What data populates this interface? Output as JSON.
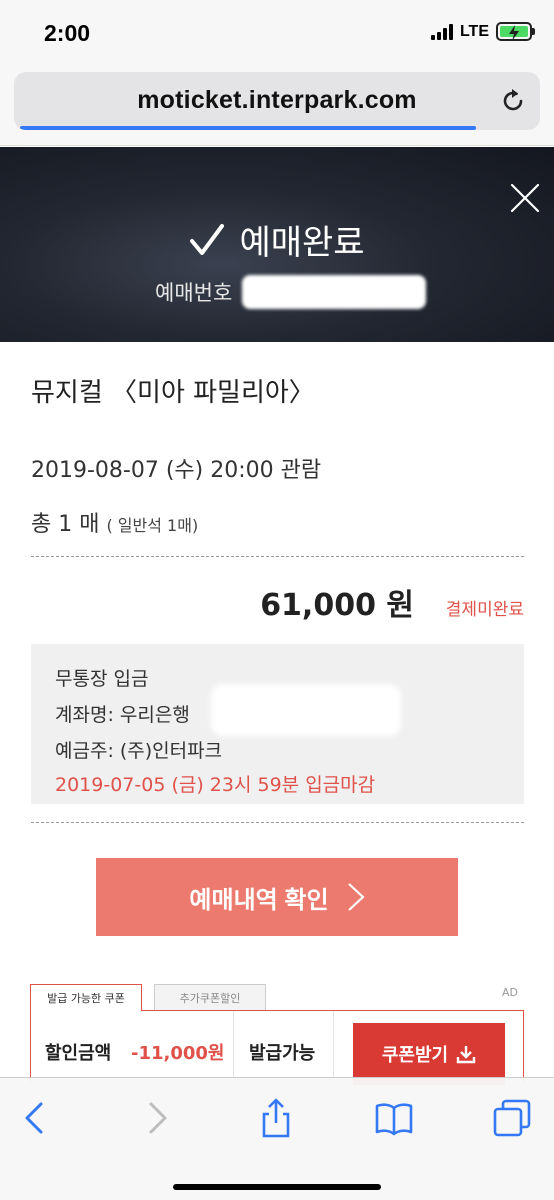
{
  "status": {
    "time": "2:00",
    "network": "LTE"
  },
  "browser": {
    "url": "moticket.interpark.com",
    "load_progress": 0.89
  },
  "banner": {
    "title": "예매완료",
    "booking_label": "예매번호"
  },
  "booking": {
    "show_title": "뮤지컬 〈미아 파밀리아〉",
    "datetime": "2019-08-07 (수) 20:00 관람",
    "qty_main": "총 1 매",
    "qty_detail": "( 일반석 1매)",
    "price": "61,000 원",
    "payment_status": "결제미완료"
  },
  "bank": {
    "method": "무통장 입금",
    "account": "계좌명: 우리은행",
    "holder": "예금주: (주)인터파크",
    "deadline": "2019-07-05 (금) 23시 59분 입금마감"
  },
  "confirm_button": {
    "label": "예매내역 확인"
  },
  "coupon": {
    "tab_active": "발급 가능한 쿠폰",
    "tab_inactive": "추가쿠폰할인",
    "ad": "AD",
    "discount_label": "할인금액",
    "discount_value": "-11,000원",
    "issuable": "발급가능",
    "button": "쿠폰받기"
  },
  "colors": {
    "accent": "#e0514a",
    "confirm_btn": "#ed7a6e",
    "coupon_btn": "#d93b34",
    "link_blue": "#3478f6"
  },
  "icons": [
    "signal-icon",
    "battery-icon",
    "reload-icon",
    "close-icon",
    "check-icon",
    "chevron-right-icon",
    "download-icon",
    "back-icon",
    "forward-icon",
    "share-icon",
    "bookmarks-icon",
    "tabs-icon"
  ]
}
